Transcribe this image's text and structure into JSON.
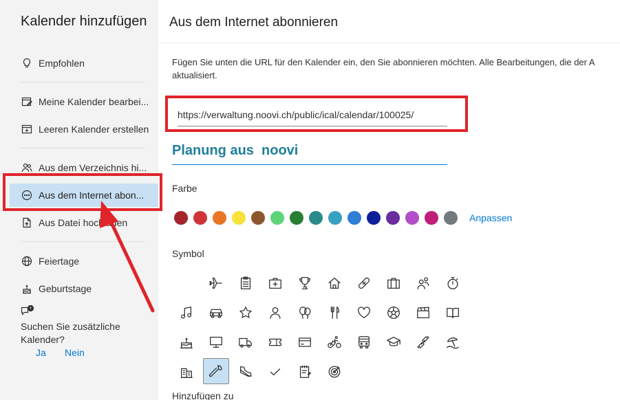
{
  "nav": {
    "title": "Kalender hinzufügen",
    "items": [
      {
        "label": "Empfohlen",
        "icon": "lightbulb-icon"
      },
      {
        "label": "Meine Kalender bearbei...",
        "icon": "edit-calendar-icon"
      },
      {
        "label": "Leeren Kalender erstellen",
        "icon": "add-calendar-icon"
      },
      {
        "label": "Aus dem Verzeichnis hi...",
        "icon": "people-icon"
      },
      {
        "label": "Aus dem Internet abon...",
        "icon": "globe-link-icon"
      },
      {
        "label": "Aus Datei hochladen",
        "icon": "file-upload-icon"
      },
      {
        "label": "Feiertage",
        "icon": "globe-icon"
      },
      {
        "label": "Geburtstage",
        "icon": "cake-icon"
      }
    ],
    "suggest_text": "Suchen Sie zusätzliche Kalender?",
    "yes": "Ja",
    "no": "Nein"
  },
  "main": {
    "title": "Aus dem Internet abonnieren",
    "desc_line1": "Fügen Sie unten die URL für den Kalender ein, den Sie abonnieren möchten. Alle Bearbeitungen, die der A",
    "desc_line2": "aktualisiert.",
    "url_value": "https://verwaltung.noovi.ch/public/ical/calendar/100025/",
    "calendar_name": "Planung aus  noovi",
    "color_label": "Farbe",
    "colors": [
      "#a4262c",
      "#d13438",
      "#ea7524",
      "#f7e13a",
      "#8e562e",
      "#5dd47a",
      "#278031",
      "#2b8a8a",
      "#3aa0c2",
      "#2f7dd6",
      "#0f1e99",
      "#6b2e9e",
      "#b04fc7",
      "#c11d7b",
      "#727a7e"
    ],
    "customize": "Anpassen",
    "symbol_label": "Symbol",
    "add_to_label": "Hinzufügen zu",
    "symbols": [
      "airplane-icon",
      "clipboard-icon",
      "medical-kit-icon",
      "trophy-icon",
      "home-icon",
      "bandage-icon",
      "briefcase-icon",
      "people-icon",
      "stopwatch-icon",
      "music-note-icon",
      "car-icon",
      "star-icon",
      "person-icon",
      "balloon-icon",
      "fork-knife-icon",
      "heart-icon",
      "soccer-ball-icon",
      "clapperboard-icon",
      "book-icon",
      "birthday-cake-icon",
      "monitor-icon",
      "truck-icon",
      "ticket-icon",
      "credit-card-icon",
      "cyclist-icon",
      "bus-icon",
      "graduation-cap-icon",
      "dumbbell-icon",
      "beach-icon",
      "buildings-icon",
      "wrench-icon",
      "sneaker-icon",
      "checkmark-icon",
      "notepad-icon",
      "target-icon"
    ]
  }
}
